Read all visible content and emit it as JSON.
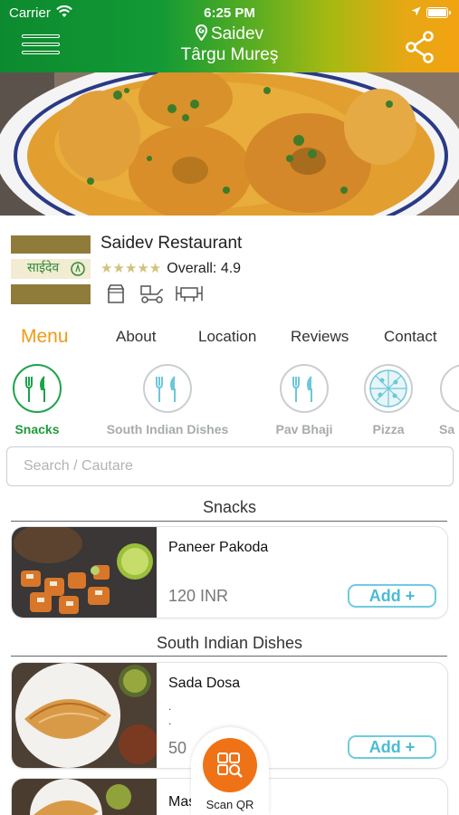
{
  "status_bar": {
    "carrier": "Carrier",
    "time": "6:25 PM"
  },
  "header": {
    "title": "Saidev",
    "subtitle": "Târgu Mureş"
  },
  "restaurant": {
    "name": "Saidev Restaurant",
    "stars": "★★★★★",
    "rating_label": "Overall: 4.9",
    "logo_text": "साईदेव",
    "services": [
      "takeaway-icon",
      "delivery-icon",
      "dine-in-icon"
    ]
  },
  "tabs": [
    {
      "label": "Menu",
      "active": true
    },
    {
      "label": "About"
    },
    {
      "label": "Location"
    },
    {
      "label": "Reviews"
    },
    {
      "label": "Contact"
    }
  ],
  "categories": [
    {
      "label": "Snacks",
      "icon": "cutlery-icon",
      "active": true
    },
    {
      "label": "South Indian Dishes",
      "icon": "cutlery-icon"
    },
    {
      "label": "Pav Bhaji",
      "icon": "cutlery-icon"
    },
    {
      "label": "Pizza",
      "icon": "pizza-icon"
    },
    {
      "label": "Sa",
      "icon": "cutlery-icon"
    }
  ],
  "search": {
    "placeholder": "Search / Cautare"
  },
  "sections": [
    {
      "title": "Snacks",
      "items": [
        {
          "name": "Paneer Pakoda",
          "price": "120 INR",
          "add_label": "Add +"
        }
      ]
    },
    {
      "title": "South Indian Dishes",
      "items": [
        {
          "name": "Sada Dosa",
          "dots": ". .",
          "price": "50",
          "add_label": "Add +"
        },
        {
          "name": "Mas"
        }
      ]
    }
  ],
  "scan_qr": {
    "label": "Scan QR"
  },
  "colors": {
    "accent_orange": "#f09a16",
    "green": "#1f9a3a",
    "add_blue": "#4bbbd5",
    "scan_orange": "#f07216"
  }
}
